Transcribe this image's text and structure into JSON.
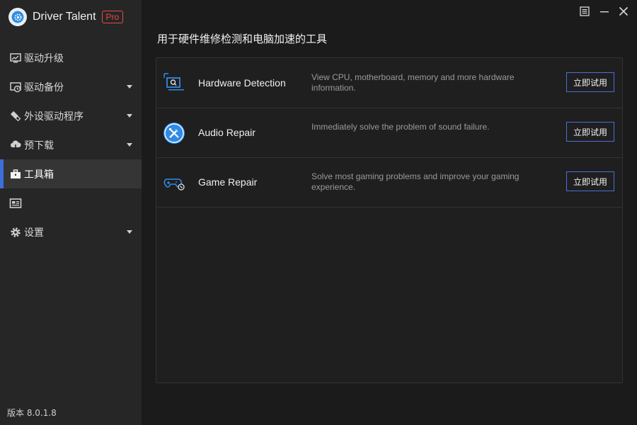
{
  "app": {
    "name": "Driver Talent",
    "edition_badge": "Pro",
    "version_text": "版本 8.0.1.8"
  },
  "window_controls": [
    "menu-icon",
    "minimize-icon",
    "close-icon"
  ],
  "sidebar": {
    "items": [
      {
        "label": "驱动升级",
        "icon": "monitor-icon",
        "has_caret": false,
        "active": false
      },
      {
        "label": "驱动备份",
        "icon": "backup-icon",
        "has_caret": true,
        "active": false
      },
      {
        "label": "外设驱动程序",
        "icon": "usb-icon",
        "has_caret": true,
        "active": false
      },
      {
        "label": "预下载",
        "icon": "cloud-download-icon",
        "has_caret": true,
        "active": false
      },
      {
        "label": "工具箱",
        "icon": "toolbox-icon",
        "has_caret": false,
        "active": true
      },
      {
        "label": "",
        "icon": "news-icon",
        "has_caret": false,
        "active": false
      },
      {
        "label": "设置",
        "icon": "gear-icon",
        "has_caret": true,
        "active": false
      }
    ]
  },
  "main": {
    "title": "用于硬件维修检测和电脑加速的工具",
    "tools": [
      {
        "name": "Hardware Detection",
        "icon": "hardware-detection-icon",
        "description": "View CPU, motherboard, memory and more hardware information.",
        "button_label": "立即试用"
      },
      {
        "name": "Audio Repair",
        "icon": "audio-repair-icon",
        "description": "Immediately solve the problem of sound failure.",
        "button_label": "立即试用"
      },
      {
        "name": "Game Repair",
        "icon": "game-repair-icon",
        "description": "Solve most gaming problems and improve your gaming experience.",
        "button_label": "立即试用"
      }
    ]
  },
  "colors": {
    "accent": "#3d6fd8",
    "pro_badge": "#e64a4a",
    "sidebar_bg": "#262626",
    "main_bg": "#1b1b1b"
  }
}
